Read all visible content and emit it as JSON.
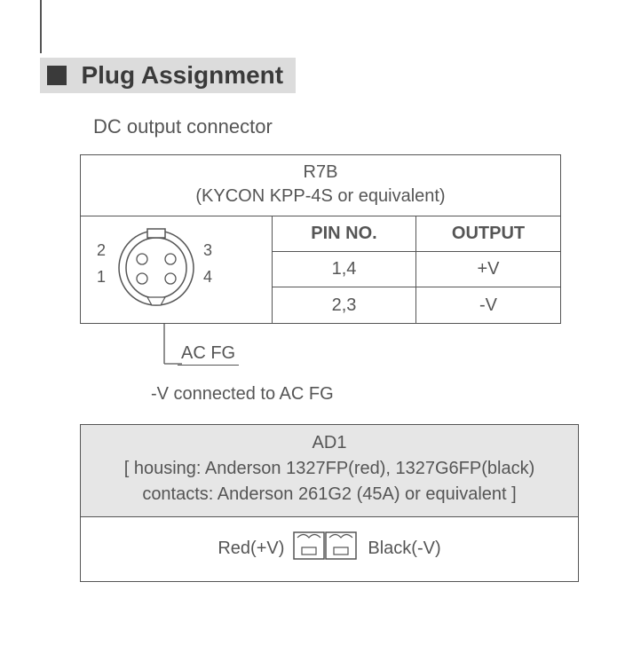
{
  "section": {
    "title": "Plug Assignment",
    "subtitle": "DC output connector"
  },
  "r7b": {
    "model": "R7B",
    "part": "(KYCON KPP-4S or equivalent)",
    "headers": {
      "pin": "PIN NO.",
      "output": "OUTPUT"
    },
    "rows": [
      {
        "pin": "1,4",
        "output": "+V"
      },
      {
        "pin": "2,3",
        "output": "-V"
      }
    ],
    "diagram_labels": {
      "p1": "1",
      "p2": "2",
      "p3": "3",
      "p4": "4"
    },
    "acfg_label": "AC FG",
    "note": "-V connected to AC FG"
  },
  "ad1": {
    "model": "AD1",
    "line1": "[ housing: Anderson 1327FP(red), 1327G6FP(black)",
    "line2": "contacts: Anderson 261G2 (45A) or equivalent ]",
    "red_label": "Red(+V)",
    "black_label": "Black(-V)"
  }
}
